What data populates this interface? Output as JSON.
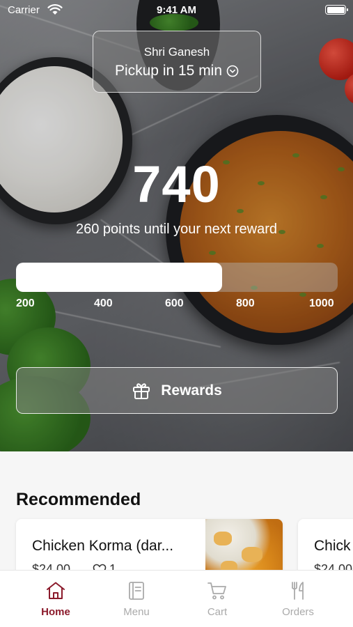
{
  "status_bar": {
    "carrier": "Carrier",
    "time": "9:41 AM"
  },
  "pickup": {
    "store_name": "Shri Ganesh",
    "pickup_label": "Pickup in 15 min"
  },
  "loyalty": {
    "points": "740",
    "caption": "260 points until your next reward",
    "progress_fraction": 0.64,
    "ticks": [
      "200",
      "400",
      "600",
      "800",
      "1000"
    ]
  },
  "rewards_button": {
    "label": "Rewards",
    "icon": "gift-icon"
  },
  "recommended": {
    "title": "Recommended",
    "items": [
      {
        "name": "Chicken Korma (dar...",
        "price": "$24.00",
        "likes": "1"
      },
      {
        "name": "Chick",
        "price": "$24.00"
      }
    ]
  },
  "tab_bar": {
    "tabs": [
      {
        "label": "Home",
        "icon": "home-icon",
        "active": true
      },
      {
        "label": "Menu",
        "icon": "menu-icon",
        "active": false
      },
      {
        "label": "Cart",
        "icon": "cart-icon",
        "active": false
      },
      {
        "label": "Orders",
        "icon": "orders-icon",
        "active": false
      }
    ],
    "active_color": "#8b1a2b",
    "inactive_color": "#aaaaaa"
  }
}
